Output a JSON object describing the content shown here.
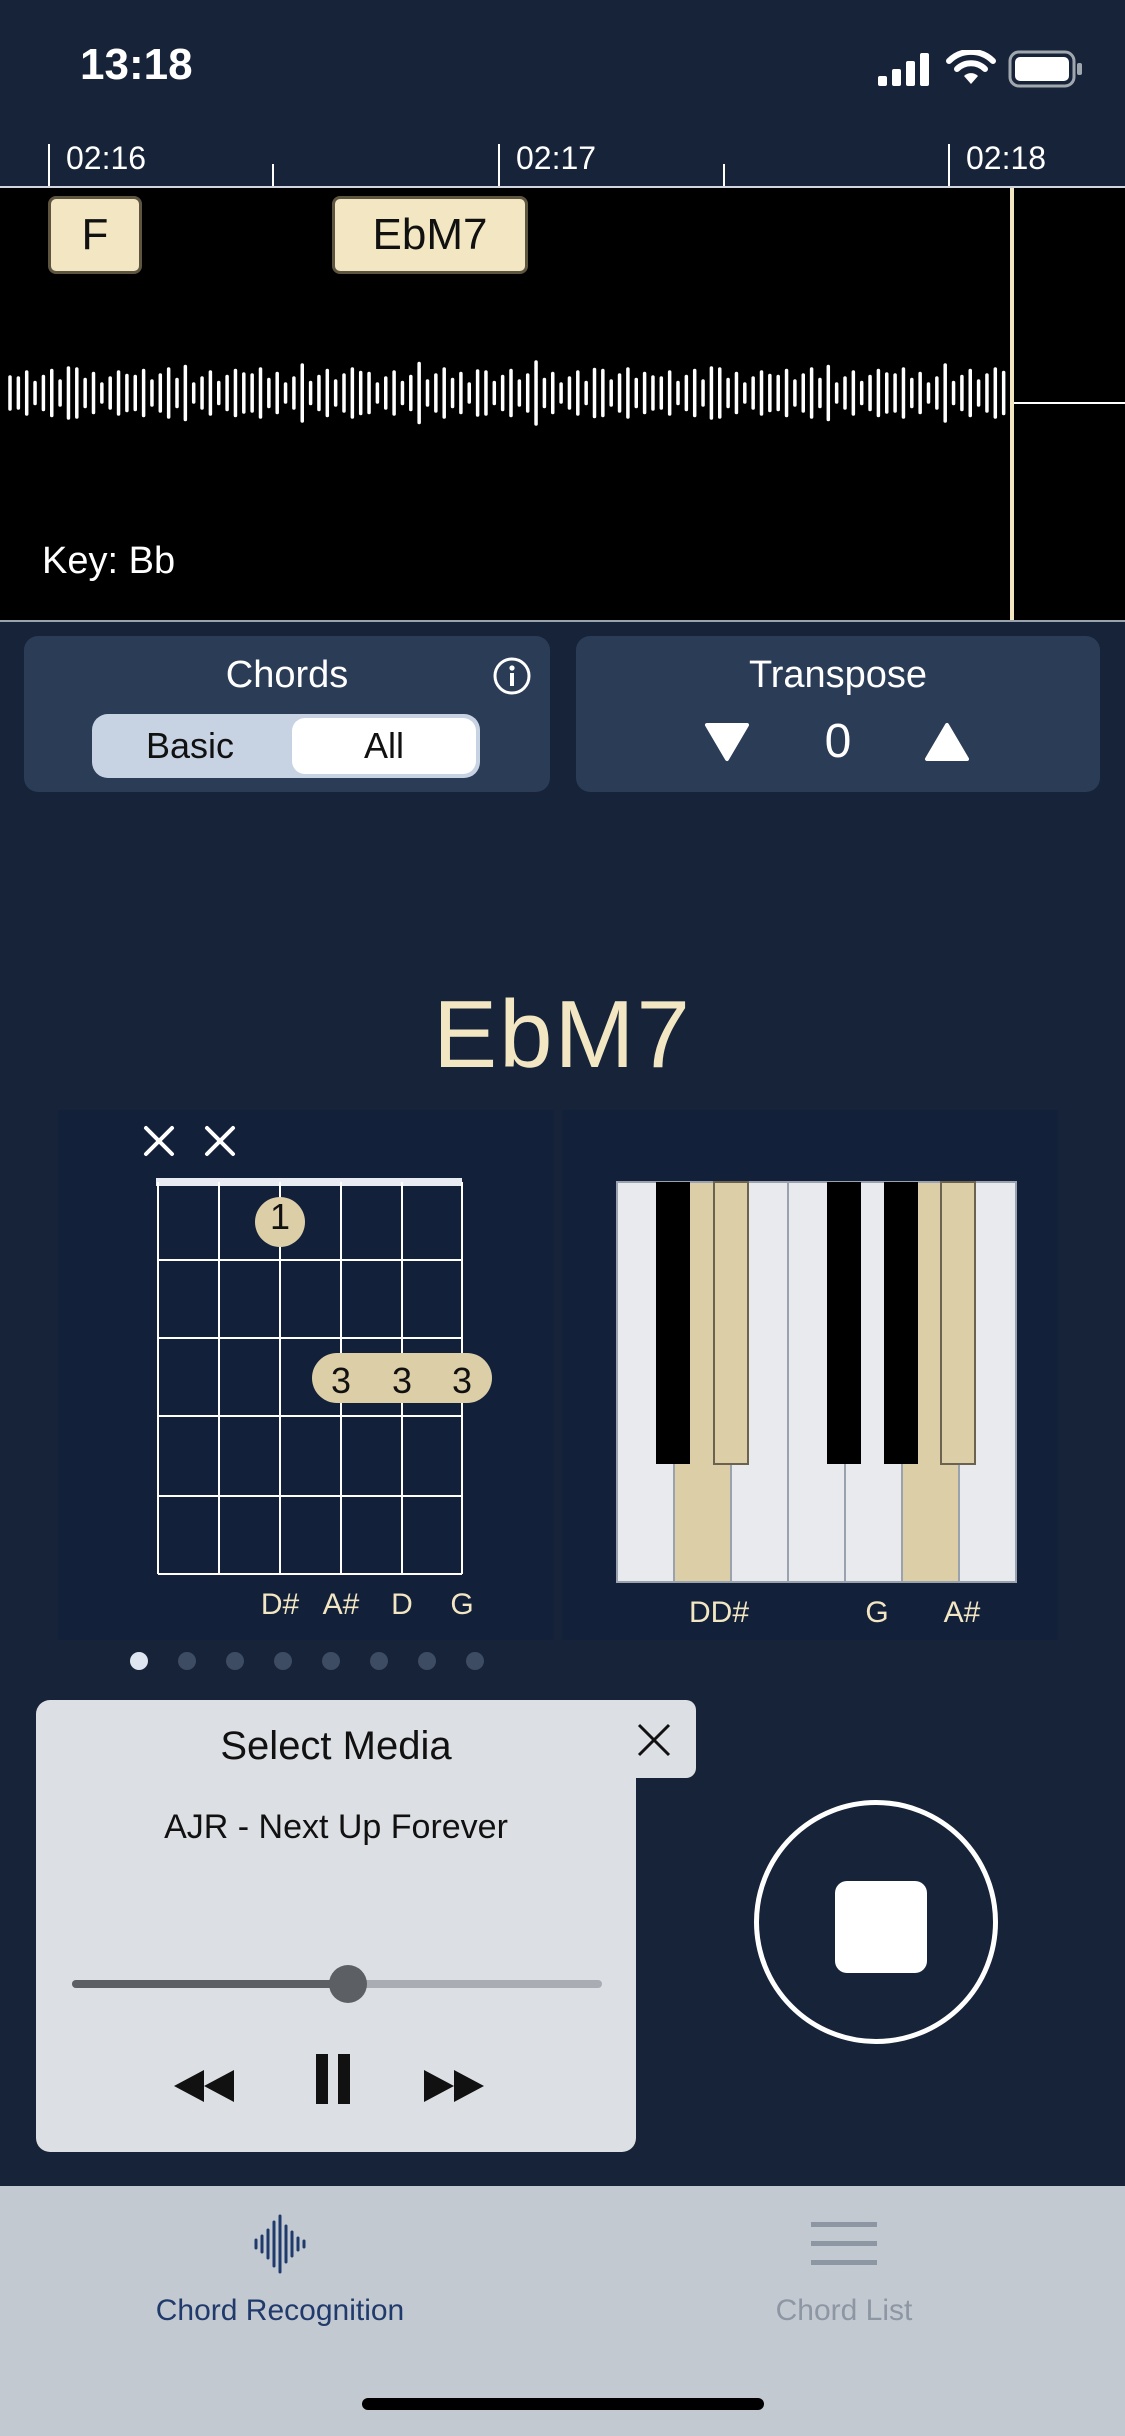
{
  "status_bar": {
    "time": "13:18"
  },
  "timeline": {
    "ticks": [
      "02:16",
      "02:17",
      "02:18"
    ]
  },
  "waveform": {
    "chords": [
      "F",
      "EbM7"
    ],
    "key_label": "Key: Bb"
  },
  "chords_panel": {
    "title": "Chords",
    "segments": {
      "basic": "Basic",
      "all": "All"
    },
    "selected": "All"
  },
  "transpose_panel": {
    "title": "Transpose",
    "value": "0"
  },
  "current_chord": "EbM7",
  "guitar": {
    "muted_strings": [
      "×",
      "×"
    ],
    "fingers": [
      "1",
      "3",
      "3",
      "3"
    ],
    "string_notes": [
      "D#",
      "A#",
      "D",
      "G"
    ]
  },
  "piano": {
    "note_labels": [
      "DD#",
      "G",
      "A#"
    ]
  },
  "pager": {
    "count": 8,
    "active": 0
  },
  "media": {
    "title": "Select Media",
    "track": "AJR - Next Up Forever",
    "progress": 0.52
  },
  "tabbar": {
    "tab1": "Chord Recognition",
    "tab2": "Chord List"
  },
  "colors": {
    "background": "#162338",
    "panel": "#2b3c56",
    "accent_cream": "#f2e7c2",
    "piano_highlight": "#dccfa8",
    "tab_active": "#1f3a6b",
    "tab_inactive": "#8d96a3"
  }
}
